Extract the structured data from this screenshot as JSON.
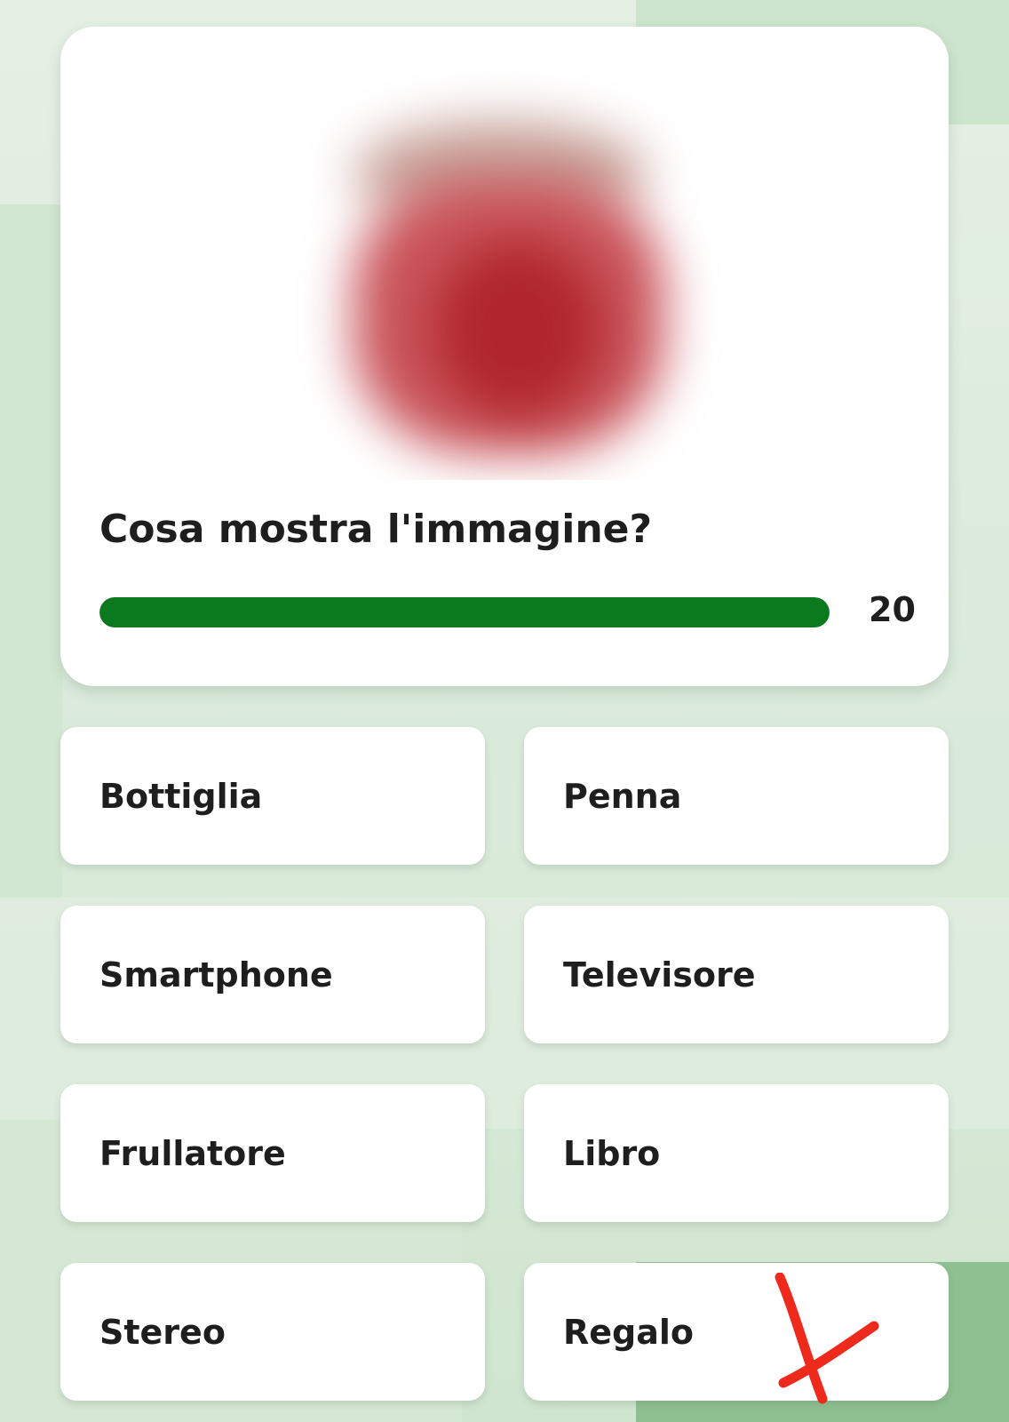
{
  "quiz": {
    "question": "Cosa mostra l'immagine?",
    "timer": {
      "value": "20",
      "fill_fraction": 1.0,
      "color": "#0b7a1e"
    },
    "image_icon": "blurred-object-image",
    "answers": [
      "Bottiglia",
      "Penna",
      "Smartphone",
      "Televisore",
      "Frullatore",
      "Libro",
      "Stereo",
      "Regalo"
    ],
    "marked_answer": "Regalo",
    "marked_icon": "red-x-mark-icon",
    "mark_color": "#ee2a1c"
  }
}
